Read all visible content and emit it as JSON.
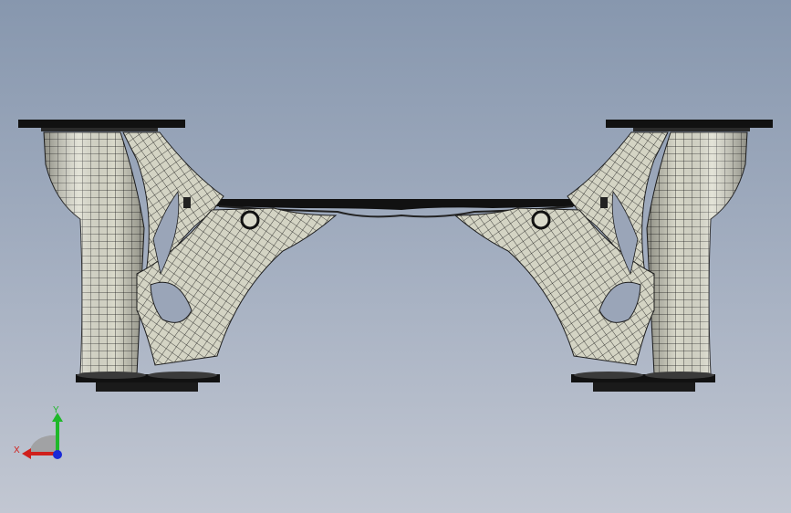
{
  "viewport": {
    "background_top": "#8797ae",
    "background_bottom": "#c2c7d2"
  },
  "model": {
    "part_fill": "#dadacb",
    "mesh_line": "#1e1e1e",
    "plate_color": "#111111"
  },
  "triad": {
    "x_label": "X",
    "y_label": "Y",
    "x_color": "#d0201c",
    "y_color": "#1fb82a",
    "z_color": "#1a2ad8"
  }
}
